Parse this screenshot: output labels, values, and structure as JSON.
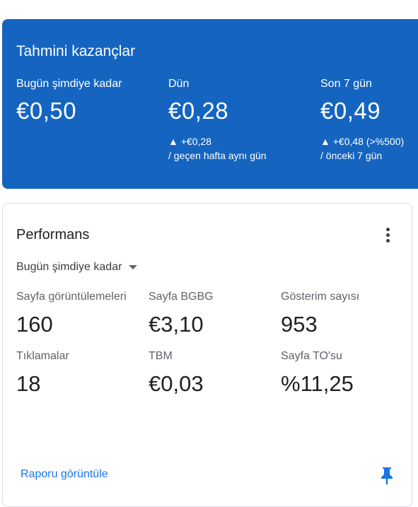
{
  "earnings": {
    "title": "Tahmini kazançlar",
    "today": {
      "label": "Bugün şimdiye kadar",
      "value": "€0,50"
    },
    "yesterday": {
      "label": "Dün",
      "value": "€0,28",
      "change": "▲ +€0,28",
      "compare": "/ geçen hafta aynı gün"
    },
    "last7": {
      "label": "Son 7 gün",
      "value": "€0,49",
      "change": "▲ +€0,48 (>%500)",
      "compare": "/ önceki 7 gün"
    }
  },
  "performance": {
    "title": "Performans",
    "range": "Bugün şimdiye kadar",
    "metrics": [
      {
        "label": "Sayfa görüntülemeleri",
        "value": "160"
      },
      {
        "label": "Sayfa BGBG",
        "value": "€3,10"
      },
      {
        "label": "Gösterim sayısı",
        "value": "953"
      },
      {
        "label": "Tıklamalar",
        "value": "18"
      },
      {
        "label": "TBM",
        "value": "€0,03"
      },
      {
        "label": "Sayfa TO'su",
        "value": "%11,25"
      }
    ],
    "report_link": "Raporu görüntüle"
  },
  "icons": {
    "menu": "more-vert-icon",
    "dropdown": "arrow-drop-down-icon",
    "pin": "pin-icon"
  },
  "colors": {
    "earnings_bg": "#1565c0",
    "link": "#1a73e8"
  }
}
